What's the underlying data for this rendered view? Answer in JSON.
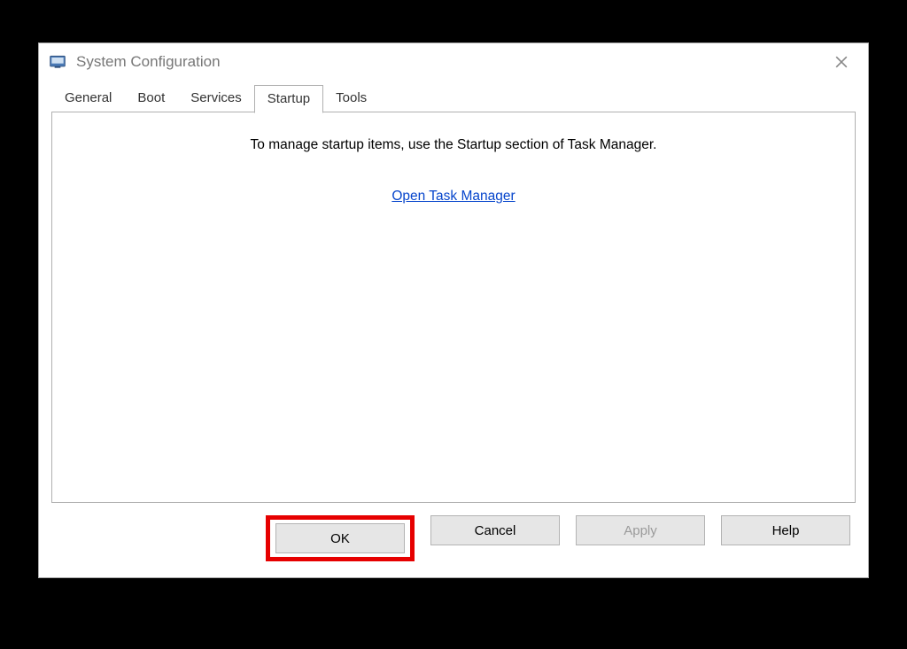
{
  "window": {
    "title": "System Configuration"
  },
  "tabs": {
    "general": "General",
    "boot": "Boot",
    "services": "Services",
    "startup": "Startup",
    "tools": "Tools",
    "active": "startup"
  },
  "panel": {
    "message": "To manage startup items, use the Startup section of Task Manager.",
    "link_label": "Open Task Manager"
  },
  "buttons": {
    "ok": "OK",
    "cancel": "Cancel",
    "apply": "Apply",
    "help": "Help"
  }
}
